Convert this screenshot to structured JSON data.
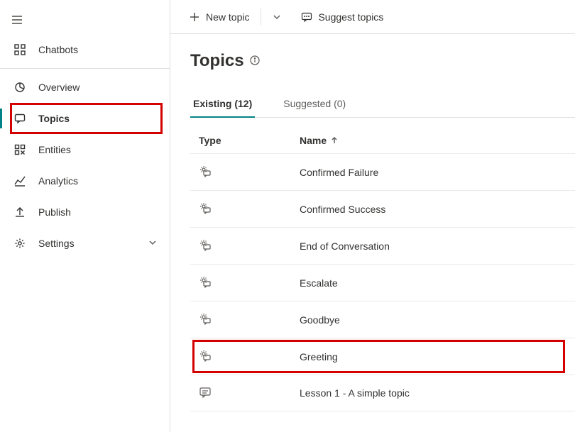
{
  "sidebar": {
    "items": [
      {
        "key": "chatbots",
        "label": "Chatbots"
      },
      {
        "key": "overview",
        "label": "Overview"
      },
      {
        "key": "topics",
        "label": "Topics"
      },
      {
        "key": "entities",
        "label": "Entities"
      },
      {
        "key": "analytics",
        "label": "Analytics"
      },
      {
        "key": "publish",
        "label": "Publish"
      },
      {
        "key": "settings",
        "label": "Settings"
      }
    ],
    "active": "topics",
    "highlighted": "topics"
  },
  "commandbar": {
    "new_topic": "New topic",
    "suggest_topics": "Suggest topics"
  },
  "page": {
    "title": "Topics"
  },
  "tabs": [
    {
      "key": "existing",
      "label": "Existing (12)",
      "active": true
    },
    {
      "key": "suggested",
      "label": "Suggested (0)",
      "active": false
    }
  ],
  "table": {
    "columns": {
      "type": "Type",
      "name": "Name"
    },
    "sort": {
      "column": "name",
      "direction": "asc"
    },
    "rows": [
      {
        "type": "system",
        "name": "Confirmed Failure"
      },
      {
        "type": "system",
        "name": "Confirmed Success"
      },
      {
        "type": "system",
        "name": "End of Conversation"
      },
      {
        "type": "system",
        "name": "Escalate"
      },
      {
        "type": "system",
        "name": "Goodbye"
      },
      {
        "type": "system",
        "name": "Greeting",
        "highlighted": true
      },
      {
        "type": "user",
        "name": "Lesson 1 - A simple topic"
      }
    ]
  }
}
